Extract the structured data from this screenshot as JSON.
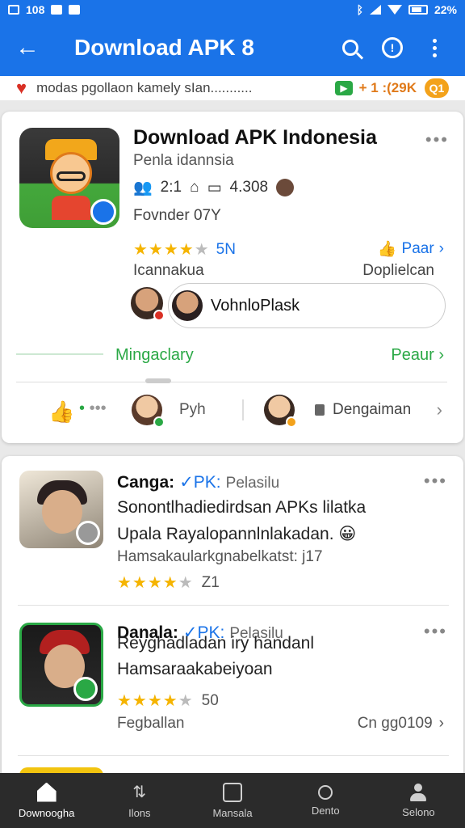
{
  "status_bar": {
    "left_text": "108",
    "battery_text": "22%"
  },
  "app_bar": {
    "title": "Download APK 8",
    "back_icon": "arrow-left-icon",
    "search_icon": "search-icon",
    "download_icon": "download-circle-icon",
    "more_icon": "more-vert-icon"
  },
  "strip": {
    "text": "modas pgollaon kamely sIan...........",
    "badge": "▶",
    "value": "+ 1 :(29K",
    "coin": "Q1"
  },
  "main_card": {
    "title": "Download APK Indonesia",
    "subtitle": "Penla idannsia",
    "stat1": "2:1",
    "stat2": "4.308",
    "founder": "Fovnder 07Y",
    "rating_count": "5N",
    "rating_stars": 4,
    "like_label": "Paar",
    "category": "Icannakua",
    "popular": "Doplielcan",
    "developer_name": "VohnloPlask",
    "section_label": "Mingaclary",
    "section_link": "Peaur",
    "row_name1": "Pyh",
    "row_name2": "Dengaiman"
  },
  "list": {
    "items": [
      {
        "name": "Canga:",
        "verified": "✓PK:",
        "publisher": "Pelasilu",
        "desc1": "Sonontlhadiedirdsan APKs lilatka",
        "desc2": "Upala Rayalopannlnlakadan. 😀",
        "meta": "Hamsakaularkgnabelkatst: j17",
        "stars": 4,
        "rating": "Z1"
      },
      {
        "name": "Danala:",
        "verified": "✓PK:",
        "publisher": "Pelasilu",
        "desc1": "Reyghadladan iry handanl",
        "desc2": "Hamsaraakabeiyoan",
        "stars": 4,
        "rating": "50",
        "footer_left": "Fegballan",
        "footer_right": "Cn gg0109"
      }
    ]
  },
  "bottom_nav": {
    "items": [
      {
        "label": "Downoogha",
        "icon": "home-icon"
      },
      {
        "label": "Ilons",
        "icon": "apps-icon"
      },
      {
        "label": "Mansala",
        "icon": "download-box-icon"
      },
      {
        "label": "Dento",
        "icon": "search-icon"
      },
      {
        "label": "Selono",
        "icon": "profile-icon"
      }
    ]
  },
  "colors": {
    "primary": "#1a73e8",
    "green": "#2aa845",
    "star": "#f5b400",
    "nav_bg": "#2b2b2b"
  }
}
